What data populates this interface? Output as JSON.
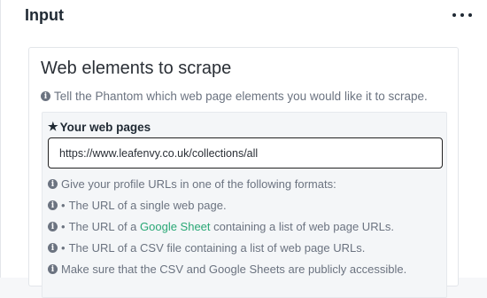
{
  "header": {
    "title": "Input",
    "more_icon": "more-horizontal-icon"
  },
  "section": {
    "title": "Web elements to scrape",
    "description": "Tell the Phantom which web page elements you would like it to scrape.",
    "field": {
      "label": "Your web pages",
      "required_icon": "star-icon",
      "value": "https://www.leafenvy.co.uk/collections/all",
      "hints": {
        "intro": "Give your profile URLs in one of the following formats:",
        "single_page": "The URL of a single web page.",
        "google_sheet_prefix": "The URL of a ",
        "google_sheet_link": "Google Sheet",
        "google_sheet_suffix": " containing a list of web page URLs.",
        "csv_file": "The URL of a CSV file containing a list of web page URLs.",
        "access_note": "Make sure that the CSV and Google Sheets are publicly accessible."
      },
      "bullet": "•"
    }
  },
  "colors": {
    "link": "#2aa876",
    "hint_text": "#6b7380",
    "title_text": "#1f2933"
  }
}
